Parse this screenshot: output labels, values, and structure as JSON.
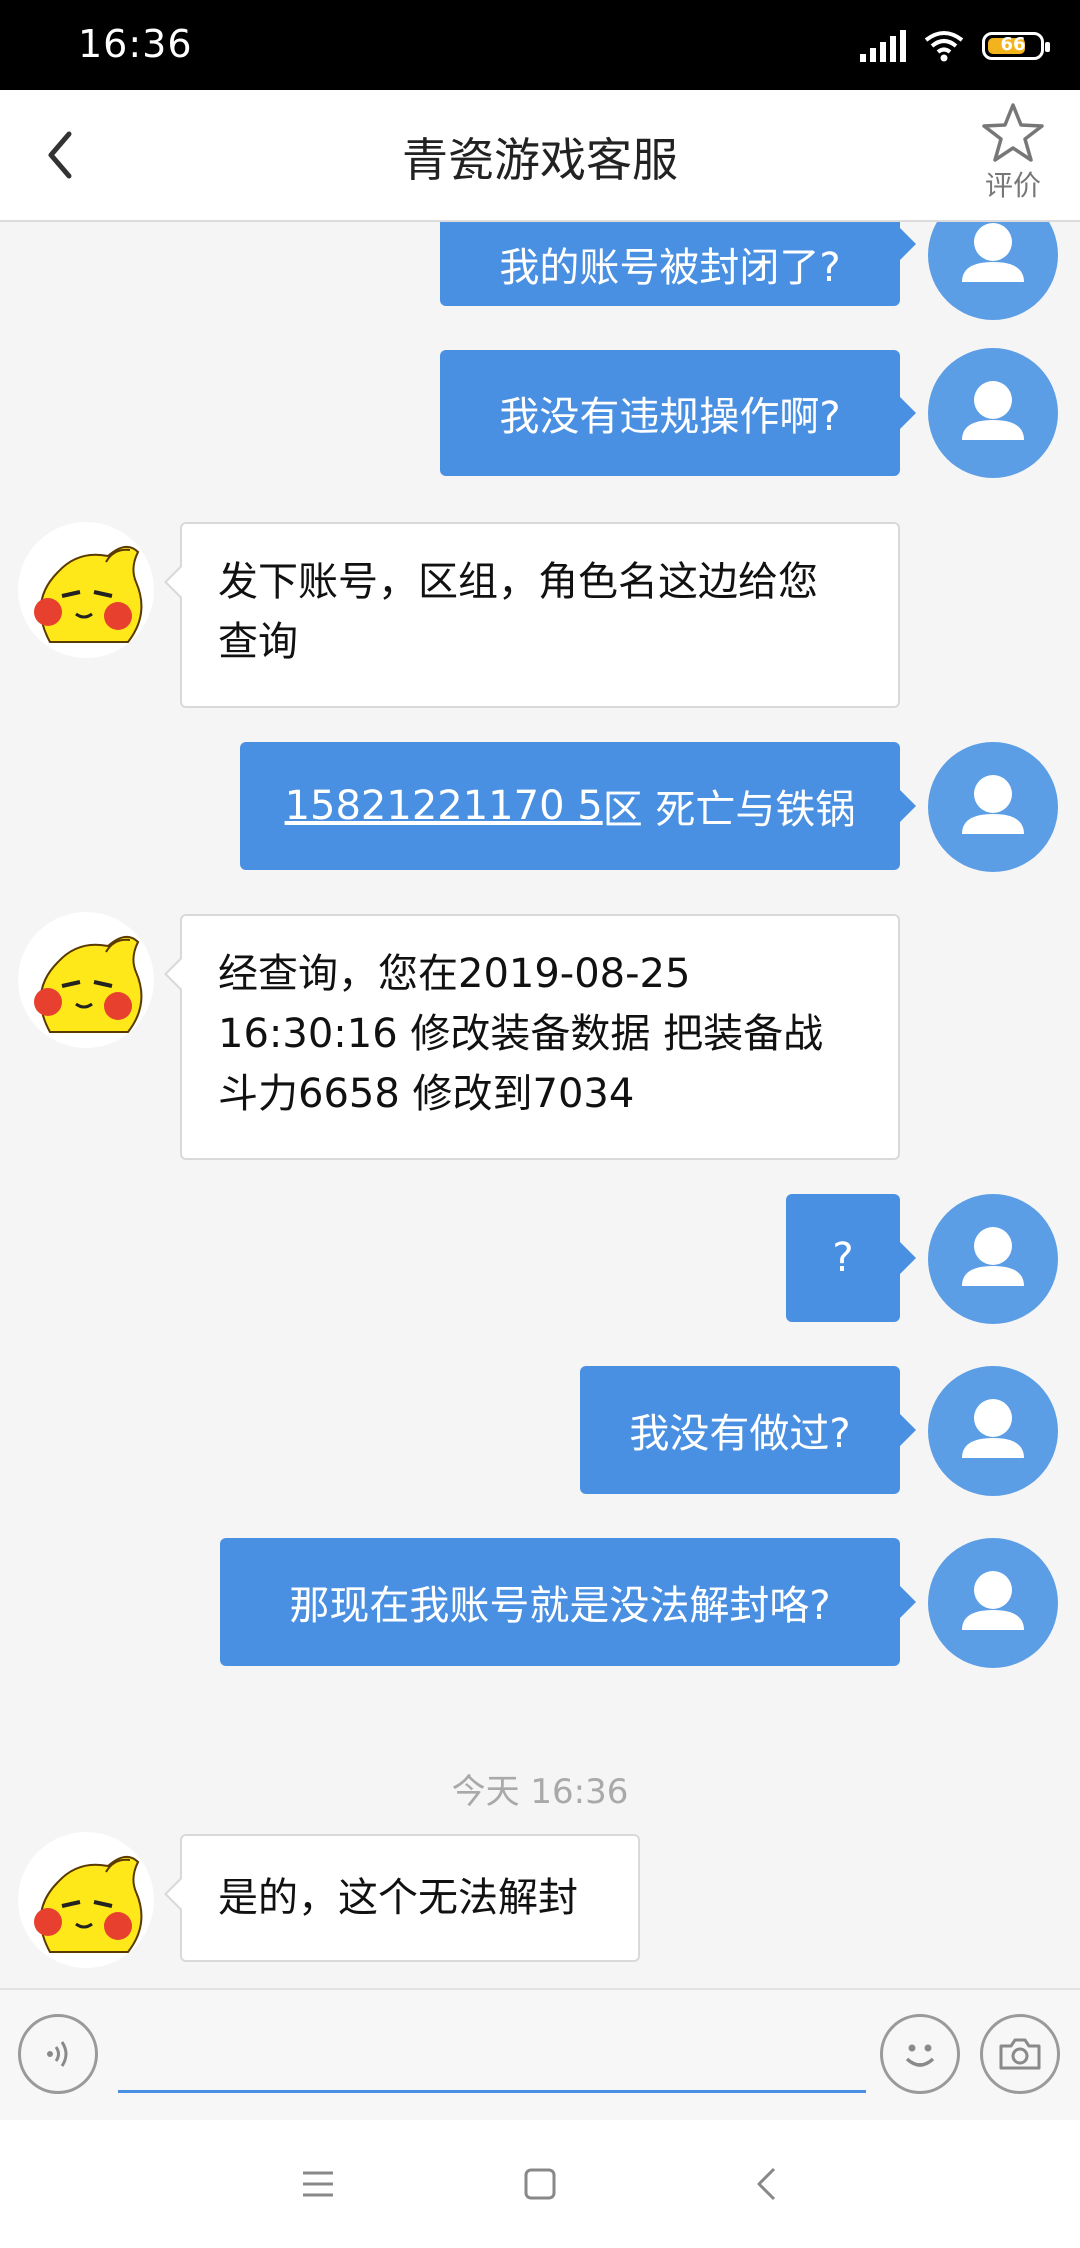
{
  "status_bar": {
    "time": "16:36",
    "battery": "66"
  },
  "header": {
    "title": "青瓷游戏客服",
    "rate_label": "评价"
  },
  "messages": {
    "m1": "我的账号被封闭了?",
    "m2": "我没有违规操作啊?",
    "m3_line1": "发下账号，区组，角色名这边给您",
    "m3_line2": "查询",
    "m4_link": "15821221170 5",
    "m4_rest": "区 死亡与铁锅",
    "m5_line1": "经查询，您在2019-08-25",
    "m5_line2": "16:30:16 修改装备数据  把装备战",
    "m5_line3": "斗力6658 修改到7034",
    "m6": "?",
    "m7": "我没有做过?",
    "m8": "那现在我账号就是没法解封咯?",
    "timestamp": "今天 16:36",
    "m9": "是的，这个无法解封"
  },
  "input": {
    "value": "",
    "placeholder": ""
  },
  "icons": {
    "voice": "voice-icon",
    "emoji": "emoji-icon",
    "camera": "camera-icon",
    "back": "back-chevron-icon",
    "star": "star-icon"
  },
  "colors": {
    "accent": "#4a90e2",
    "user_avatar": "#5c9ee6",
    "background": "#f5f5f5"
  }
}
